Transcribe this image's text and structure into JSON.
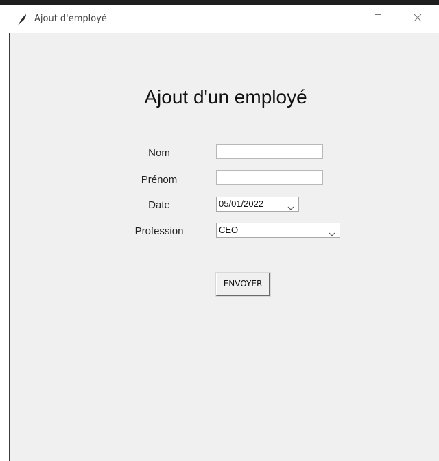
{
  "window": {
    "title": "Ajout d'employé"
  },
  "form": {
    "heading": "Ajout d'un employé",
    "fields": {
      "nom": {
        "label": "Nom",
        "value": ""
      },
      "prenom": {
        "label": "Prénom",
        "value": ""
      },
      "date": {
        "label": "Date",
        "value": "05/01/2022"
      },
      "profession": {
        "label": "Profession",
        "value": "CEO"
      }
    },
    "submit_label": "ENVOYER"
  },
  "icons": {
    "app": "feather-icon",
    "minimize": "minimize-icon",
    "maximize": "maximize-icon",
    "close": "close-icon",
    "dropdown": "chevron-down-icon"
  }
}
